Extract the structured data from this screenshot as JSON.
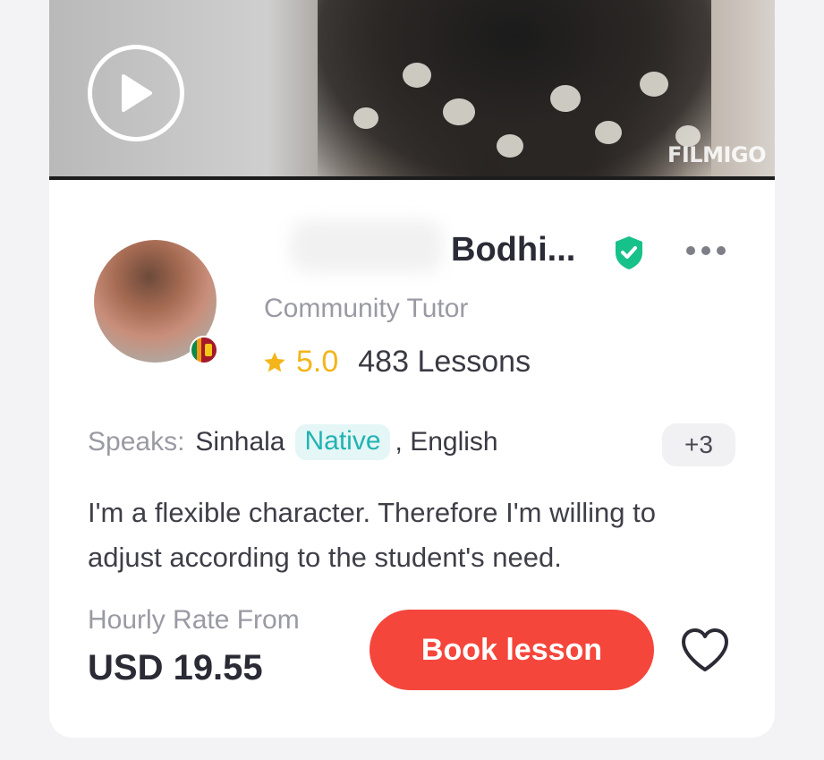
{
  "video": {
    "watermark": "FILMIGO",
    "play_icon": "play-circle-icon"
  },
  "tutor": {
    "name": "Bodhi...",
    "verified_icon": "shield-check-icon",
    "type": "Community Tutor",
    "rating": "5.0",
    "lessons": "483 Lessons",
    "flag": "sri-lanka-flag-icon"
  },
  "languages": {
    "label": "Speaks:",
    "primary": "Sinhala",
    "primary_level": "Native",
    "secondary": ", English",
    "more": "+3"
  },
  "bio": "I'm a flexible character. Therefore I'm willing to adjust according to the student's need.",
  "pricing": {
    "label": "Hourly Rate From",
    "value": "USD 19.55"
  },
  "actions": {
    "book_label": "Book lesson",
    "favorite_icon": "heart-outline-icon",
    "more_icon": "more-horizontal-icon"
  },
  "colors": {
    "accent": "#f5463c",
    "verified": "#17c18a",
    "rating": "#f3b51a",
    "native_badge_text": "#21b3b3"
  }
}
